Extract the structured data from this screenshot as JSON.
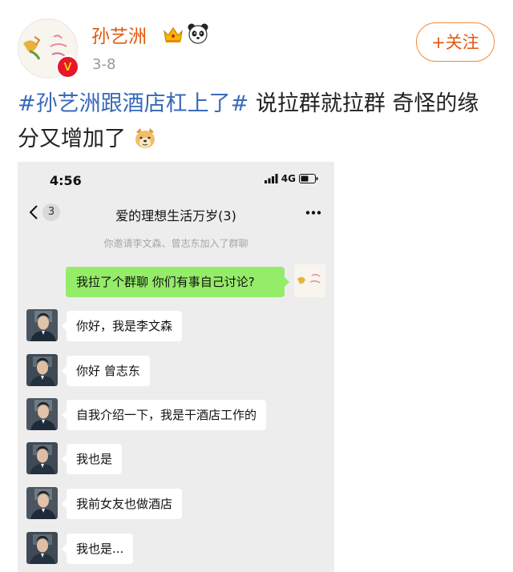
{
  "post": {
    "user_name": "孙艺洲",
    "time": "3-8",
    "follow_label": "+关注",
    "hashtag": "#孙艺洲跟酒店杠上了#",
    "text": " 说拉群就拉群 奇怪的缘分又增加了",
    "icons": [
      "crown-icon",
      "panda-icon",
      "verified-icon",
      "doge-icon"
    ]
  },
  "chat": {
    "status_time": "4:56",
    "network": "4G",
    "back_count": "3",
    "title": "爱的理想生活万岁(3)",
    "system_message": "你邀请李文森、曾志东加入了群聊",
    "my_message": "我拉了个群聊 你们有事自己讨论?",
    "messages": [
      {
        "text": "你好，我是李文森"
      },
      {
        "text": "你好 曾志东"
      },
      {
        "text": "自我介绍一下，我是干酒店工作的"
      },
      {
        "text": "我也是"
      },
      {
        "text": "我前女友也做酒店"
      },
      {
        "text": "我也是..."
      }
    ]
  },
  "colors": {
    "name": "#e0590d",
    "hashtag": "#3869b8",
    "bubble_mine": "#95ec69",
    "chat_bg": "#ededed"
  }
}
